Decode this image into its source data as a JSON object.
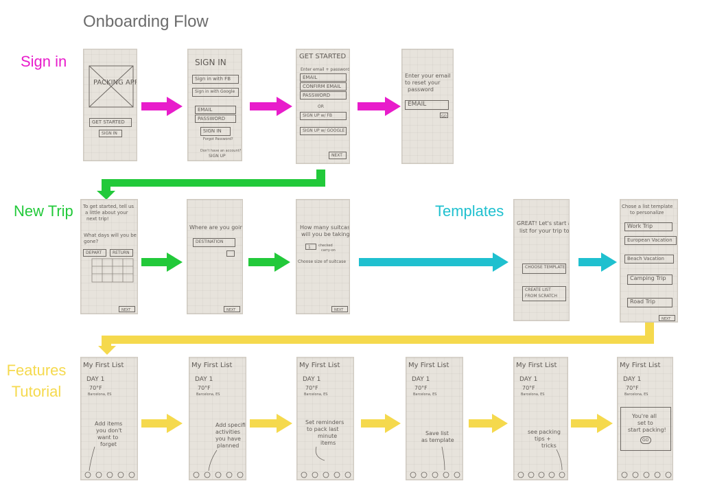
{
  "title": "Onboarding Flow",
  "rows": {
    "sign_in": "Sign in",
    "new_trip": "New Trip",
    "templates": "Templates",
    "features_line1": "Features",
    "features_line2": "Tutorial"
  },
  "colors": {
    "sign_in": "#e81ccb",
    "new_trip": "#22c93a",
    "templates": "#1fc0cf",
    "features": "#f5d94d"
  },
  "sketches": {
    "s1": {
      "logo": "PACKING APP",
      "get_started": "GET STARTED",
      "sign_in": "SIGN IN"
    },
    "s2": {
      "title": "SIGN IN",
      "fb": "Sign in with FB",
      "google": "Sign in with Google",
      "email": "EMAIL",
      "password": "PASSWORD",
      "sign_in_btn": "SIGN IN",
      "forgot": "Forgot Password?",
      "no_account": "Don't have an account?",
      "sign_up": "SIGN UP"
    },
    "s3": {
      "title": "GET STARTED",
      "hint": "Enter email + password",
      "email": "EMAIL",
      "confirm": "CONFIRM EMAIL",
      "password": "PASSWORD",
      "or": "OR",
      "fb": "SIGN UP w/ FB",
      "google": "SIGN UP w/ GOOGLE",
      "next": "NEXT"
    },
    "s4": {
      "line1": "Enter your email",
      "line2": "to reset your",
      "line3": "password",
      "email": "EMAIL",
      "go": "GO"
    },
    "t1": {
      "line1": "To get started, tell us",
      "line2": "a little about your",
      "line3": "next trip!",
      "q1": "What days will you be",
      "q2": "gone?",
      "depart": "DEPART",
      "return": "RETURN",
      "next": "NEXT"
    },
    "t2": {
      "question": "Where are you going?",
      "destination": "DESTINATION",
      "next": "NEXT"
    },
    "t3": {
      "q1": "How many suitcases",
      "q2": "will you be taking?",
      "count": "1",
      "checked": "checked",
      "carry_on": "carry-on",
      "size": "Choose size of suitcase",
      "next": "NEXT"
    },
    "p1": {
      "line1": "GREAT! Let's start a",
      "line2": "list for your trip to",
      "choose": "CHOOSE TEMPLATE",
      "create1": "CREATE LIST",
      "create2": "FROM SCRATCH"
    },
    "p2": {
      "title": "Chose a list template",
      "title2": "to personalize",
      "items": [
        "Work Trip",
        "European Vacation",
        "Beach Vacation",
        "Camping Trip",
        "Road Trip"
      ],
      "next": "NEXT"
    },
    "f_title": "My First List",
    "f_day": "DAY 1",
    "f_temp": "70°F",
    "f_place": "Barcelona, ES",
    "f1": {
      "note1": "Add items",
      "note2": "you don't",
      "note3": "want to",
      "note4": "forget"
    },
    "f2": {
      "note1": "Add specific",
      "note2": "activities",
      "note3": "you have",
      "note4": "planned"
    },
    "f3": {
      "note1": "Set reminders",
      "note2": "to pack last",
      "note3": "minute",
      "note4": "items"
    },
    "f4": {
      "note1": "Save list",
      "note2": "as template"
    },
    "f5": {
      "note1": "see packing",
      "note2": "tips +",
      "note3": "tricks"
    },
    "f6": {
      "note1": "You're all",
      "note2": "set to",
      "note3": "start packing!",
      "go": "GO"
    }
  }
}
